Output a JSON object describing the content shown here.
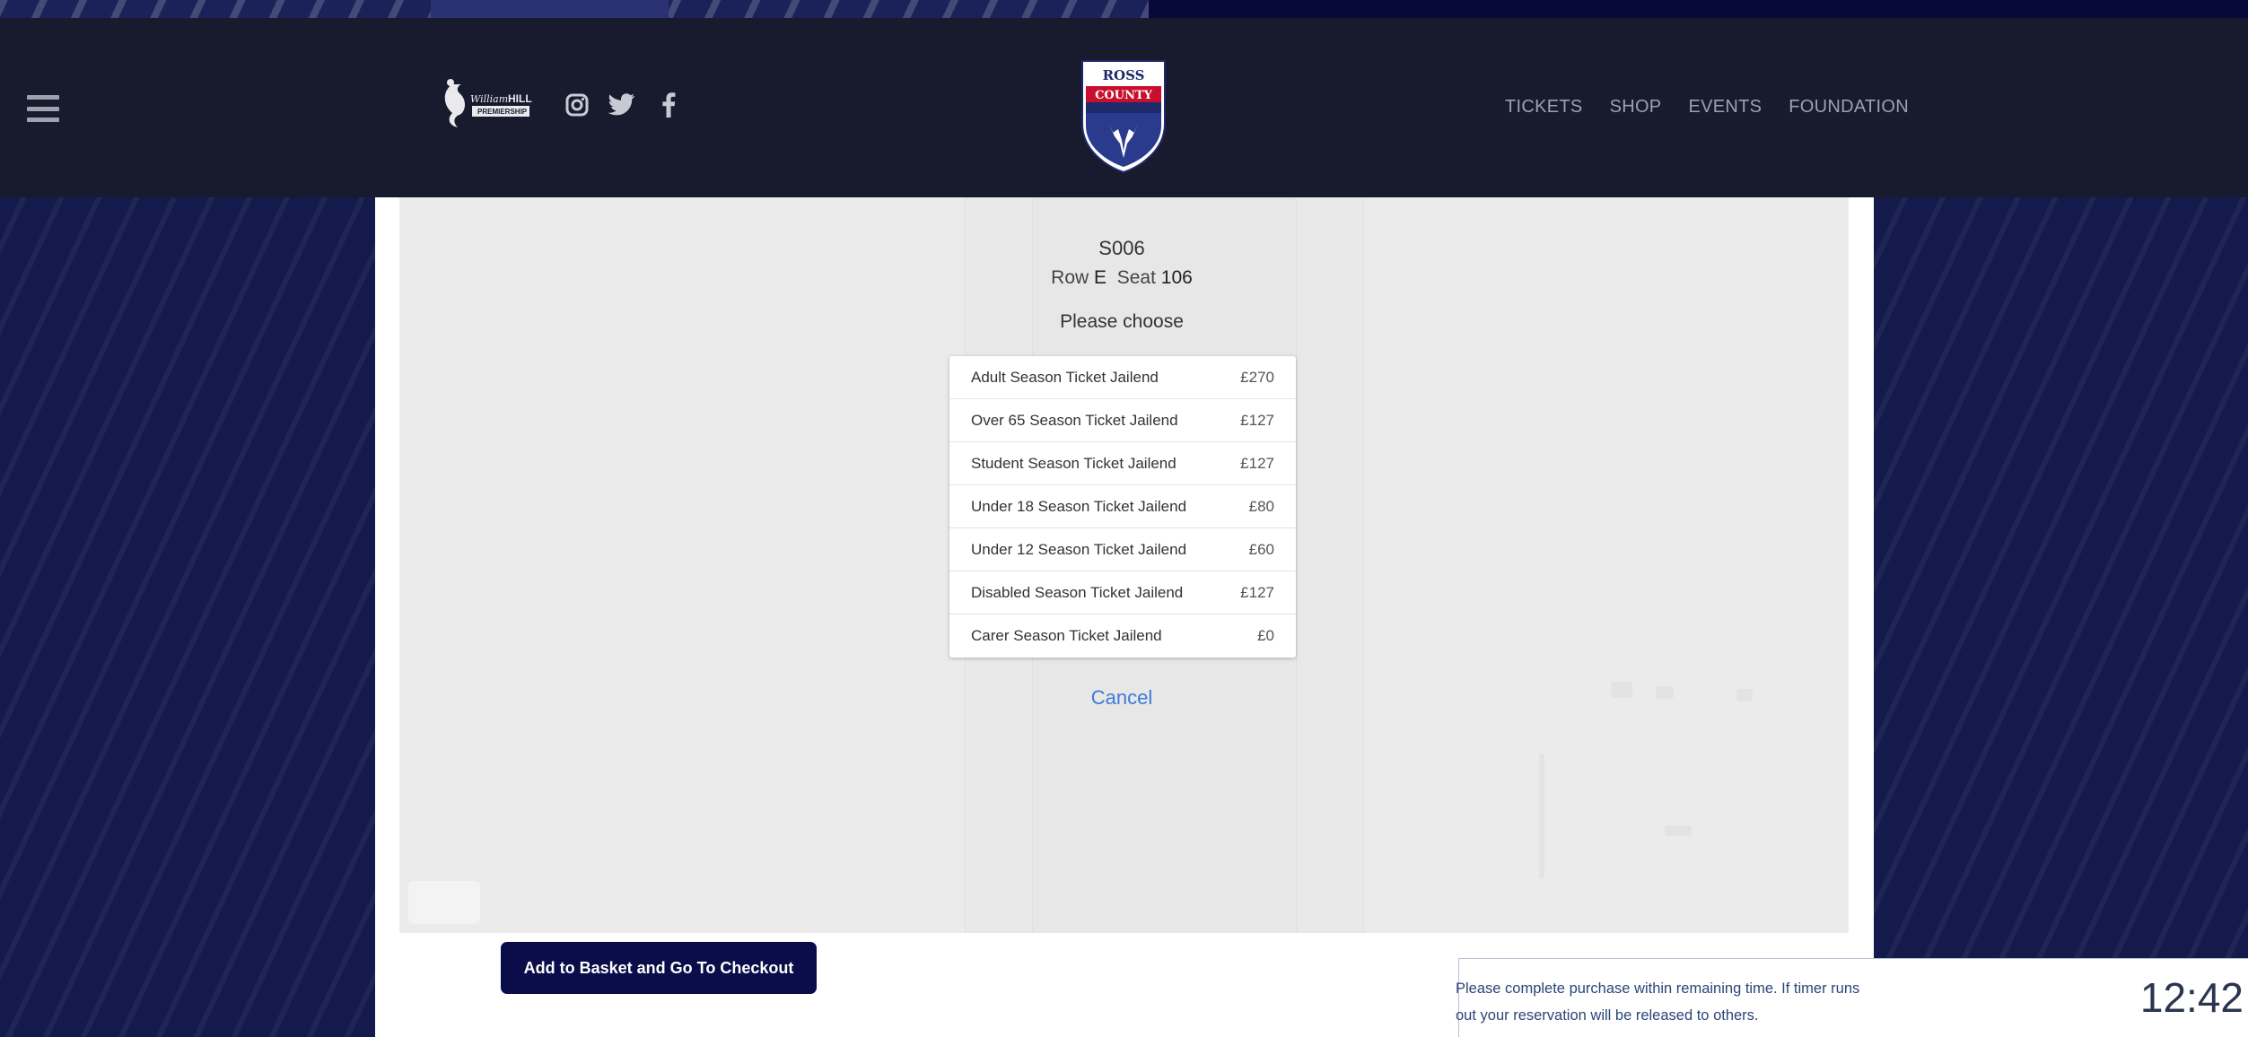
{
  "header": {
    "logo_left": "William Hill Premiership",
    "logo_center": "Ross County",
    "crest_text_top": "ROSS",
    "crest_text_bottom": "COUNTY",
    "social_icons": [
      "instagram-icon",
      "twitter-icon",
      "facebook-icon"
    ],
    "nav": [
      "TICKETS",
      "SHOP",
      "EVENTS",
      "FOUNDATION"
    ]
  },
  "seat": {
    "code": "S006",
    "row_label": "Row",
    "row_value": "E",
    "seat_label": "Seat",
    "seat_value": "106",
    "prompt": "Please choose"
  },
  "ticket_options": [
    {
      "label": "Adult Season Ticket Jailend",
      "price": "£270"
    },
    {
      "label": "Over 65 Season Ticket Jailend",
      "price": "£127"
    },
    {
      "label": "Student Season Ticket Jailend",
      "price": "£127"
    },
    {
      "label": "Under 18 Season Ticket Jailend",
      "price": "£80"
    },
    {
      "label": "Under 12 Season Ticket Jailend",
      "price": "£60"
    },
    {
      "label": "Disabled Season Ticket Jailend",
      "price": "£127"
    },
    {
      "label": "Carer Season Ticket Jailend",
      "price": "£0"
    }
  ],
  "actions": {
    "cancel": "Cancel",
    "checkout": "Add to Basket and Go To Checkout"
  },
  "timer": {
    "message_line1": "Please complete purchase within remaining time. If timer runs",
    "message_line2": "out your reservation will be released to others.",
    "remaining": "12:42"
  },
  "colors": {
    "header_bg": "#181a2e",
    "page_bg": "#141a4b",
    "button_bg": "#0a0d4a",
    "link": "#3f7ad9"
  }
}
